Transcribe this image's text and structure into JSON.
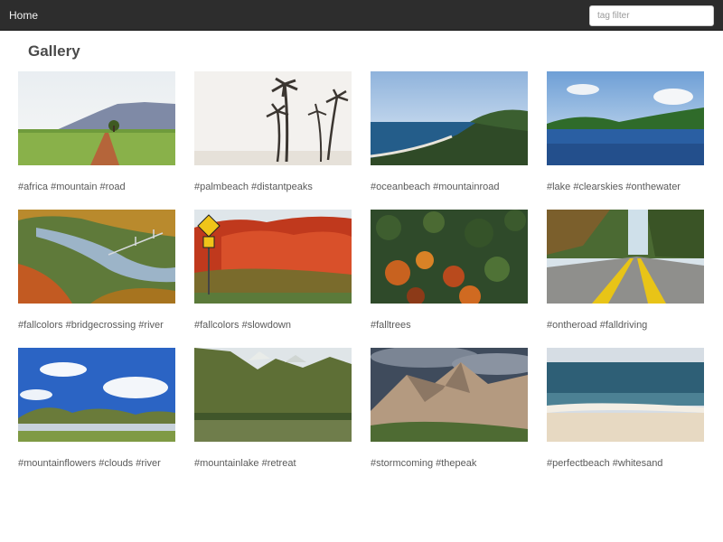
{
  "navbar": {
    "home_label": "Home",
    "filter_placeholder": "tag filter"
  },
  "page_title": "Gallery",
  "gallery": {
    "items": [
      {
        "caption": "#africa #mountain #road"
      },
      {
        "caption": "#palmbeach #distantpeaks"
      },
      {
        "caption": "#oceanbeach #mountainroad"
      },
      {
        "caption": "#lake #clearskies #onthewater"
      },
      {
        "caption": "#fallcolors #bridgecrossing #river"
      },
      {
        "caption": "#fallcolors #slowdown"
      },
      {
        "caption": "#falltrees"
      },
      {
        "caption": "#ontheroad #falldriving"
      },
      {
        "caption": "#mountainflowers #clouds #river"
      },
      {
        "caption": "#mountainlake #retreat"
      },
      {
        "caption": "#stormcoming #thepeak"
      },
      {
        "caption": "#perfectbeach #whitesand"
      }
    ]
  }
}
